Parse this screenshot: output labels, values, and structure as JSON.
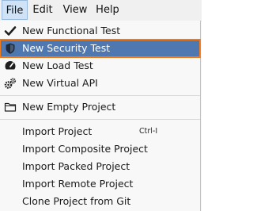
{
  "menubar": {
    "file": "File",
    "edit": "Edit",
    "view": "View",
    "help": "Help"
  },
  "file_menu": {
    "items": [
      {
        "label": "New Functional Test",
        "icon": "checkmark-icon"
      },
      {
        "label": "New Security Test",
        "icon": "shield-icon",
        "selected": true
      },
      {
        "label": "New Load Test",
        "icon": "speedometer-icon"
      },
      {
        "label": "New Virtual API",
        "icon": "gears-icon"
      },
      {
        "label": "New Empty Project",
        "icon": "folder-icon"
      },
      {
        "label": "Import Project",
        "shortcut": "Ctrl-I"
      },
      {
        "label": "Import Composite Project"
      },
      {
        "label": "Import Packed Project"
      },
      {
        "label": "Import Remote Project"
      },
      {
        "label": "Clone Project from Git"
      }
    ]
  },
  "colors": {
    "selection": "#4f77b0",
    "highlight_border": "#f07a1a"
  }
}
